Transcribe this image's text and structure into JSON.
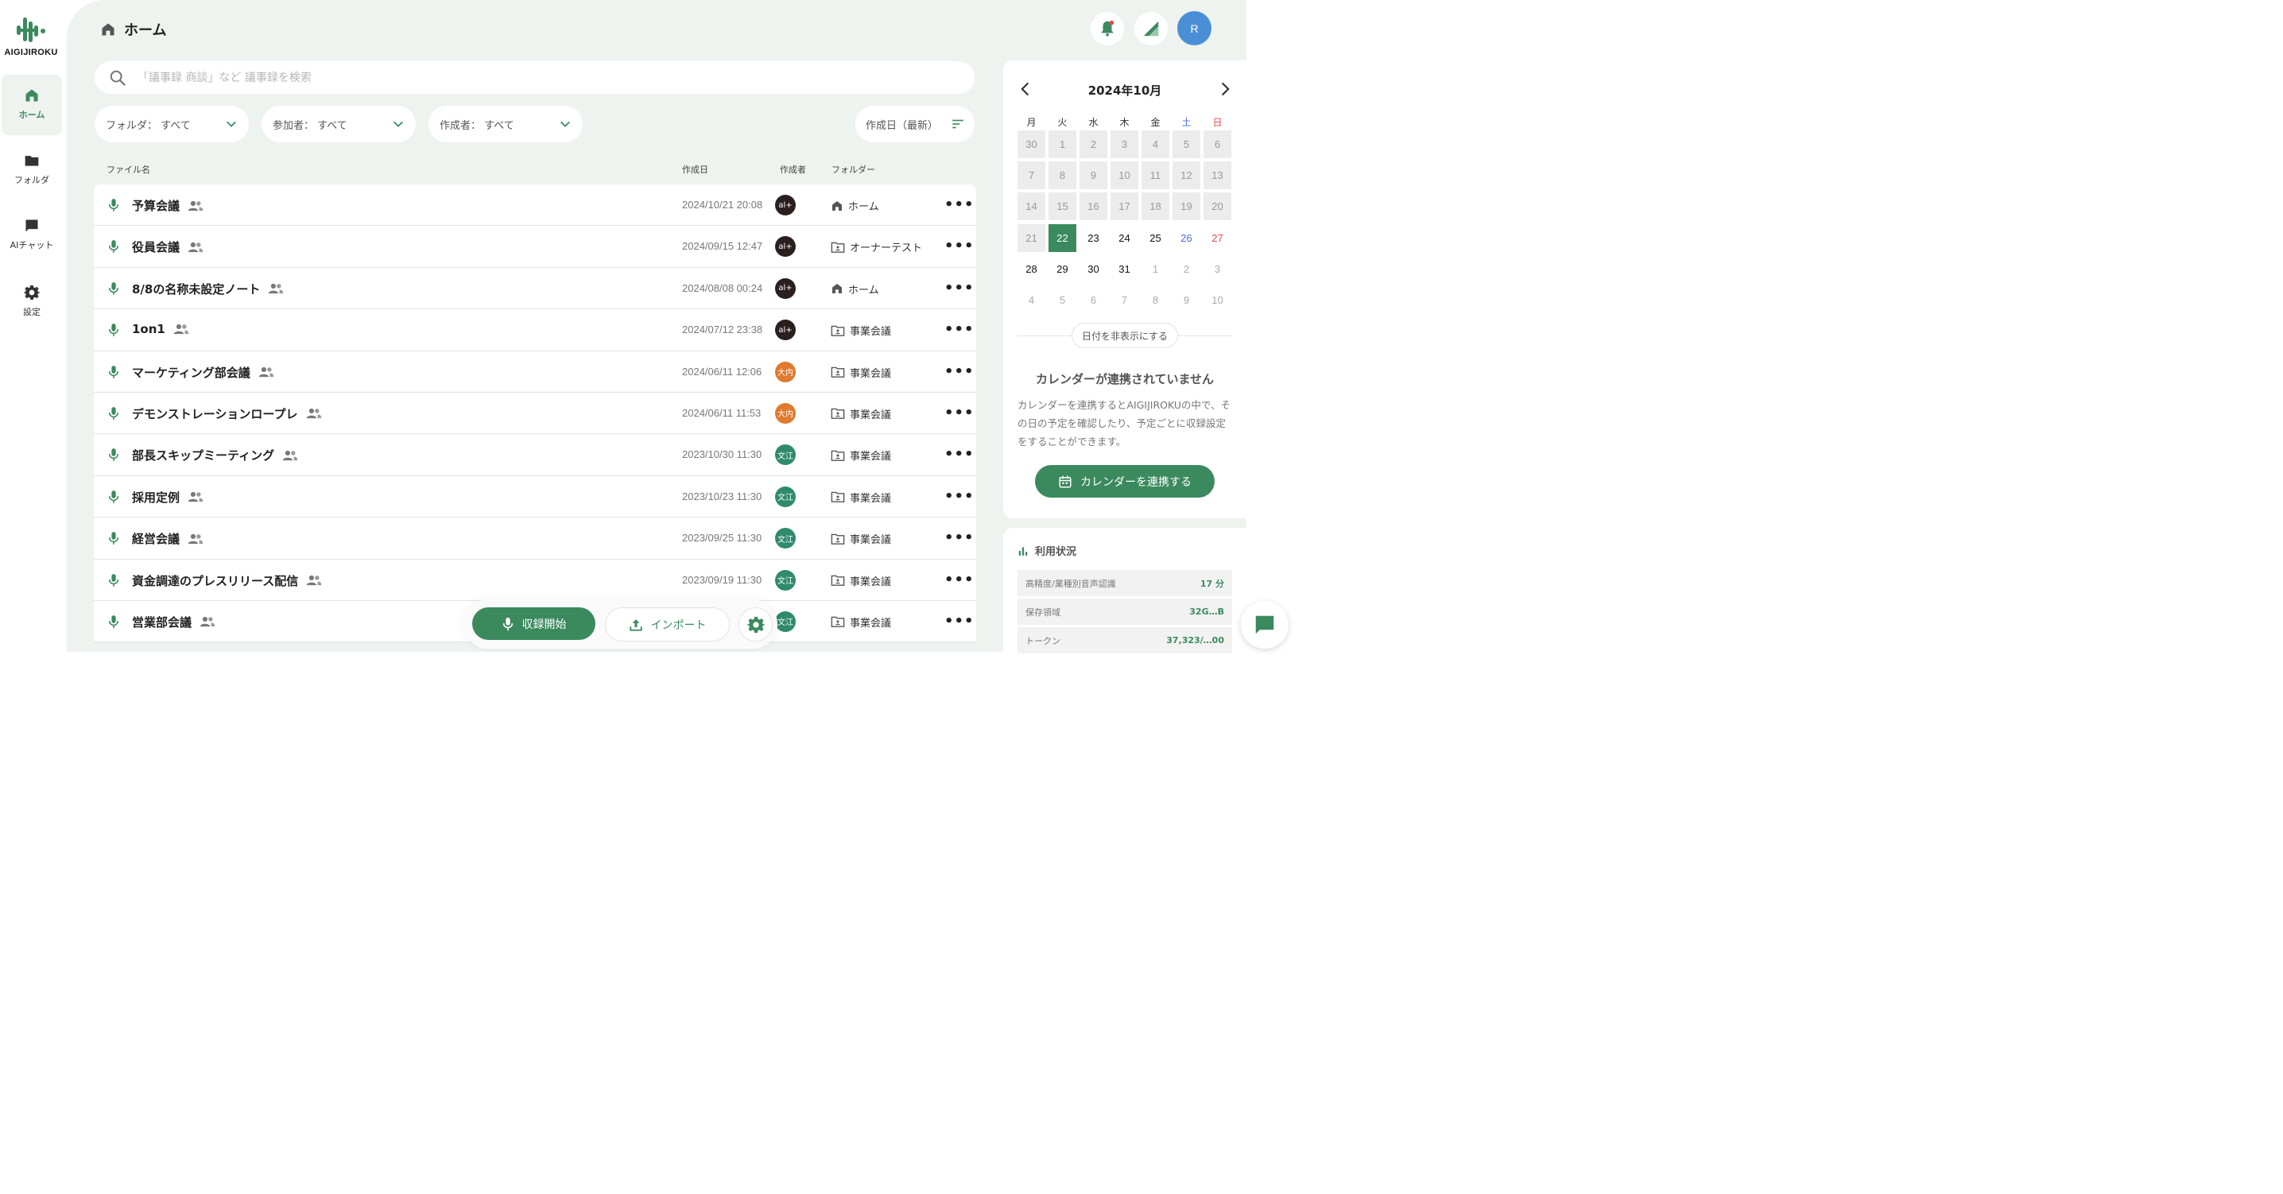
{
  "brand": {
    "name": "AIGIJIROKU",
    "accent": "#3b8a5e"
  },
  "sidebar": {
    "items": [
      {
        "label": "ホーム",
        "icon": "home-icon",
        "active": true
      },
      {
        "label": "フォルダ",
        "icon": "folder-icon",
        "active": false
      },
      {
        "label": "AIチャット",
        "icon": "chat-icon",
        "active": false
      },
      {
        "label": "設定",
        "icon": "gear-icon",
        "active": false
      }
    ]
  },
  "header": {
    "title": "ホーム",
    "avatar_initial": "R"
  },
  "search": {
    "placeholder": "「議事録 商談」など 議事録を検索"
  },
  "filters": {
    "folder": "フォルダ： すべて",
    "participant": "参加者： すべて",
    "creator": "作成者： すべて",
    "sort": "作成日（最新）"
  },
  "table": {
    "columns": {
      "name": "ファイル名",
      "date": "作成日",
      "creator": "作成者",
      "folder": "フォルダー"
    },
    "rows": [
      {
        "name": "予算会議",
        "date": "2024/10/21 20:08",
        "creator": "al+",
        "creator_color": "#2a1f1f",
        "folder": "ホーム",
        "folder_icon": "home-icon"
      },
      {
        "name": "役員会議",
        "date": "2024/09/15 12:47",
        "creator": "al+",
        "creator_color": "#2a1f1f",
        "folder": "オーナーテスト",
        "folder_icon": "shared-folder-icon"
      },
      {
        "name": "8/8の名称未設定ノート",
        "date": "2024/08/08 00:24",
        "creator": "al+",
        "creator_color": "#2a1f1f",
        "folder": "ホーム",
        "folder_icon": "home-icon"
      },
      {
        "name": "1on1",
        "date": "2024/07/12 23:38",
        "creator": "al+",
        "creator_color": "#2a1f1f",
        "folder": "事業会議",
        "folder_icon": "shared-folder-icon"
      },
      {
        "name": "マーケティング部会議",
        "date": "2024/06/11 12:06",
        "creator": "大内",
        "creator_color": "#e07a2e",
        "folder": "事業会議",
        "folder_icon": "shared-folder-icon"
      },
      {
        "name": "デモンストレーションロープレ",
        "date": "2024/06/11 11:53",
        "creator": "大内",
        "creator_color": "#e07a2e",
        "folder": "事業会議",
        "folder_icon": "shared-folder-icon"
      },
      {
        "name": "部長スキップミーティング",
        "date": "2023/10/30 11:30",
        "creator": "文江",
        "creator_color": "#2f8a6e",
        "folder": "事業会議",
        "folder_icon": "shared-folder-icon"
      },
      {
        "name": "採用定例",
        "date": "2023/10/23 11:30",
        "creator": "文江",
        "creator_color": "#2f8a6e",
        "folder": "事業会議",
        "folder_icon": "shared-folder-icon"
      },
      {
        "name": "経営会議",
        "date": "2023/09/25 11:30",
        "creator": "文江",
        "creator_color": "#2f8a6e",
        "folder": "事業会議",
        "folder_icon": "shared-folder-icon"
      },
      {
        "name": "資金調達のプレスリリース配信",
        "date": "2023/09/19 11:30",
        "creator": "文江",
        "creator_color": "#2f8a6e",
        "folder": "事業会議",
        "folder_icon": "shared-folder-icon"
      },
      {
        "name": "営業部会議",
        "date": "",
        "creator": "文江",
        "creator_color": "#2f8a6e",
        "folder": "事業会議",
        "folder_icon": "shared-folder-icon"
      }
    ]
  },
  "actions": {
    "record": "収録開始",
    "import": "インポート"
  },
  "calendar": {
    "month_title": "2024年10月",
    "weekdays": [
      "月",
      "火",
      "水",
      "木",
      "金",
      "土",
      "日"
    ],
    "weeks": [
      [
        "30",
        "1",
        "2",
        "3",
        "4",
        "5",
        "6"
      ],
      [
        "7",
        "8",
        "9",
        "10",
        "11",
        "12",
        "13"
      ],
      [
        "14",
        "15",
        "16",
        "17",
        "18",
        "19",
        "20"
      ],
      [
        "21",
        "22",
        "23",
        "24",
        "25",
        "26",
        "27"
      ],
      [
        "28",
        "29",
        "30",
        "31",
        "1",
        "2",
        "3"
      ],
      [
        "4",
        "5",
        "6",
        "7",
        "8",
        "9",
        "10"
      ]
    ],
    "today": "22",
    "saturday_color": "#4a6fd6",
    "sunday_color": "#e04a4a",
    "hide_label": "日付を非表示にする",
    "not_connected_title": "カレンダーが連携されていません",
    "not_connected_message": "カレンダーを連携するとAIGIJIROKUの中で、その日の予定を確認したり、予定ごとに収録設定をすることができます。",
    "connect_label": "カレンダーを連携する"
  },
  "usage": {
    "title": "利用状況",
    "rows": [
      {
        "label": "高精度/業種別音声認識",
        "value": "17 分"
      },
      {
        "label": "保存領域",
        "value": "32G…B"
      },
      {
        "label": "トークン",
        "value": "37,323/…00"
      }
    ]
  }
}
